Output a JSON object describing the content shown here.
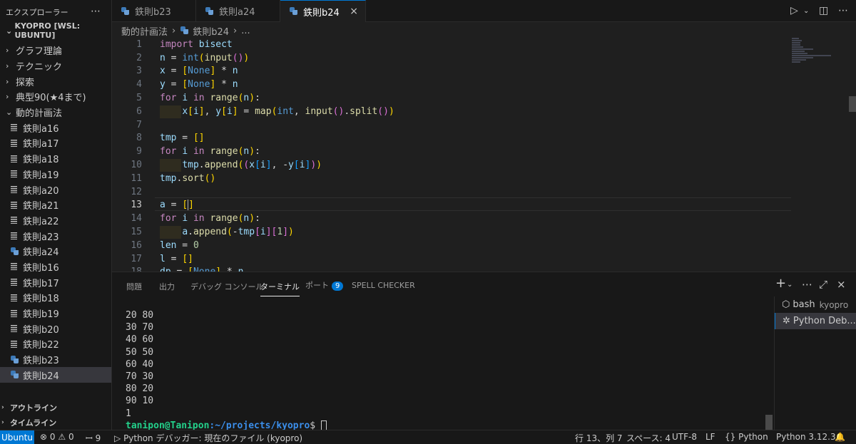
{
  "sidebar": {
    "title": "エクスプローラー",
    "root": "KYOPRO [WSL: UBUNTU]",
    "folders_top": [
      "グラフ理論",
      "テクニック",
      "探索",
      "典型90(★4まで)",
      "動的計画法"
    ],
    "files": [
      {
        "label": "鉄則a16",
        "icon": "lines"
      },
      {
        "label": "鉄則a17",
        "icon": "lines"
      },
      {
        "label": "鉄則a18",
        "icon": "lines"
      },
      {
        "label": "鉄則a19",
        "icon": "lines"
      },
      {
        "label": "鉄則a20",
        "icon": "lines"
      },
      {
        "label": "鉄則a21",
        "icon": "lines"
      },
      {
        "label": "鉄則a22",
        "icon": "lines"
      },
      {
        "label": "鉄則a23",
        "icon": "lines"
      },
      {
        "label": "鉄則a24",
        "icon": "python"
      },
      {
        "label": "鉄則b16",
        "icon": "lines"
      },
      {
        "label": "鉄則b17",
        "icon": "lines"
      },
      {
        "label": "鉄則b18",
        "icon": "lines"
      },
      {
        "label": "鉄則b19",
        "icon": "lines"
      },
      {
        "label": "鉄則b20",
        "icon": "lines"
      },
      {
        "label": "鉄則b22",
        "icon": "lines"
      },
      {
        "label": "鉄則b23",
        "icon": "python"
      },
      {
        "label": "鉄則b24",
        "icon": "python"
      }
    ],
    "outline": "アウトライン",
    "timeline": "タイムライン"
  },
  "tabs": [
    {
      "label": "鉄則b23"
    },
    {
      "label": "鉄則a24"
    },
    {
      "label": "鉄則b24"
    }
  ],
  "breadcrumb": {
    "folder": "動的計画法",
    "file": "鉄則b24",
    "more": "..."
  },
  "editor": {
    "current_line": 13,
    "line_numbers": [
      "1",
      "2",
      "3",
      "4",
      "5",
      "6",
      "7",
      "8",
      "9",
      "10",
      "11",
      "12",
      "13",
      "14",
      "15",
      "16",
      "17",
      "18"
    ]
  },
  "panel": {
    "tabs": [
      "問題",
      "出力",
      "デバッグ コンソール",
      "ターミナル",
      "ポート",
      "SPELL CHECKER"
    ],
    "ports_count": "9",
    "terminal_lines": [
      "20 80",
      "30 70",
      "40 60",
      "50 50",
      "60 40",
      "70 30",
      "80 20",
      "90 10",
      "1"
    ],
    "prompt_user": "tanipon@Tanipon",
    "prompt_path": ":~/projects/kyopro",
    "prompt_end": "$ ",
    "terminals": [
      {
        "name": "bash",
        "sub": "kyopro"
      },
      {
        "name": "Python Deb..."
      }
    ]
  },
  "statusbar": {
    "remote": "Ubuntu",
    "errors": "0",
    "warnings": "0",
    "ports": "9",
    "debug": "Python デバッガー: 現在のファイル (kyopro)",
    "position": "行 13、列 7",
    "spaces": "スペース: 4",
    "encoding": "UTF-8",
    "eol": "LF",
    "language": "Python",
    "interpreter": "Python 3.12.3"
  },
  "colors": {
    "accent": "#0078d4",
    "background": "#1f1f1f",
    "sidebar": "#181818"
  }
}
